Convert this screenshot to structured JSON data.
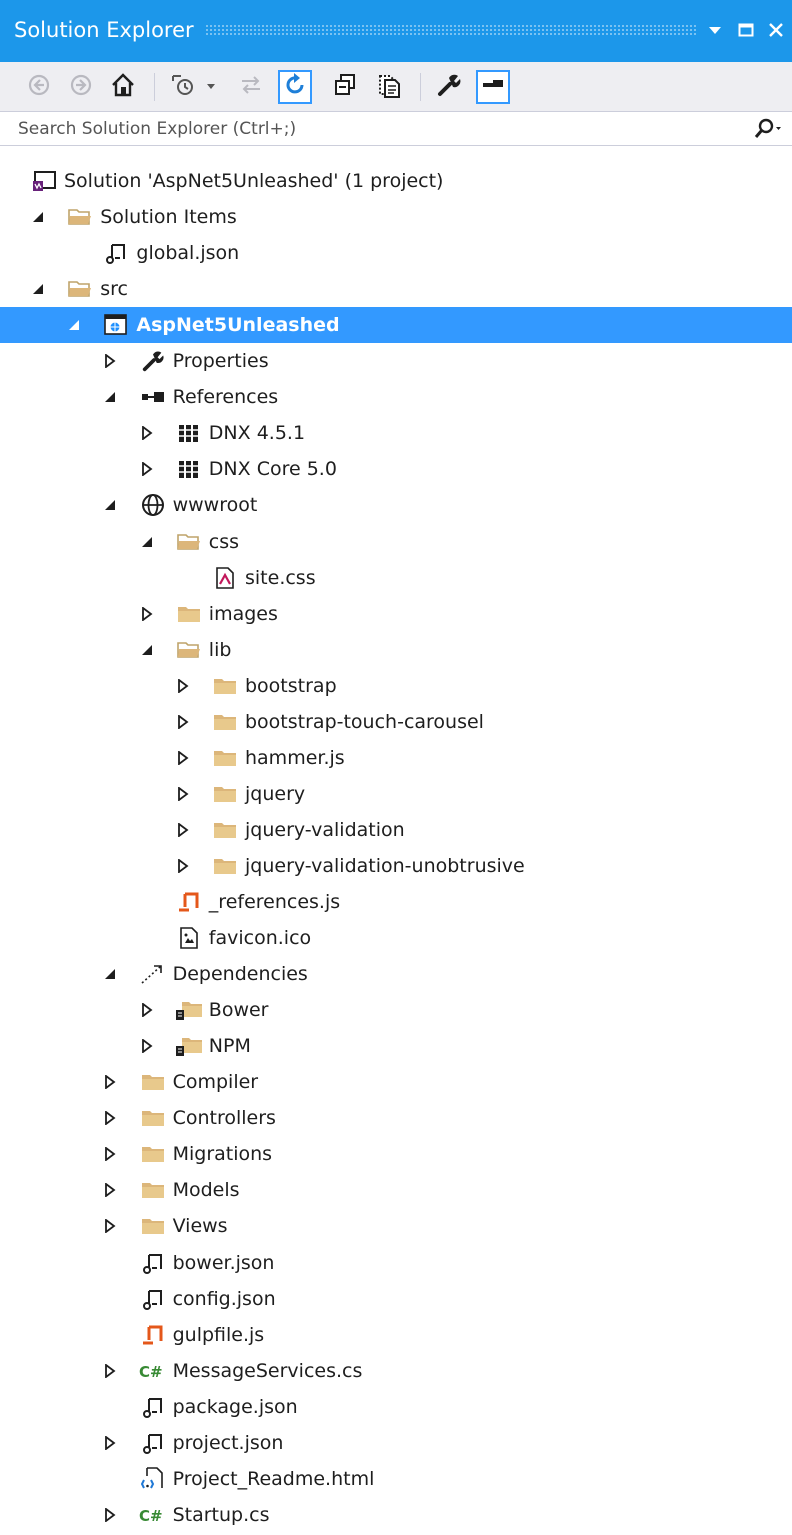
{
  "window": {
    "title": "Solution Explorer",
    "controls": {
      "dropdown_icon": "dropdown-arrow-icon",
      "maximize_icon": "maximize-icon",
      "close_icon": "close-icon"
    }
  },
  "toolbar": {
    "buttons": [
      {
        "name": "back-button",
        "icon": "back-arrow-icon"
      },
      {
        "name": "forward-button",
        "icon": "forward-arrow-icon"
      },
      {
        "name": "home-button",
        "icon": "home-icon"
      },
      {
        "name": "pending-changes-filter-button",
        "icon": "clock-filter-icon"
      },
      {
        "name": "sync-active-document-button",
        "icon": "sync-arrows-icon"
      },
      {
        "name": "refresh-button",
        "icon": "refresh-icon"
      },
      {
        "name": "collapse-all-button",
        "icon": "collapse-all-icon"
      },
      {
        "name": "show-all-files-button",
        "icon": "show-all-files-icon"
      },
      {
        "name": "properties-button",
        "icon": "wrench-icon"
      },
      {
        "name": "preview-selected-items-button",
        "icon": "preview-icon"
      }
    ]
  },
  "search": {
    "placeholder": "Search Solution Explorer (Ctrl+;)",
    "value": ""
  },
  "colors": {
    "title_bar": "#1c97ea",
    "selection": "#3399ff",
    "toolbar_bg": "#eeeef2",
    "folder": "#dcb67a",
    "csharp": "#388a34",
    "js_orange": "#e4571a"
  },
  "tree": [
    {
      "label": "Solution 'AspNet5Unleashed' (1 project)",
      "icon": "solution-icon",
      "expander": "none",
      "depth": 0
    },
    {
      "label": "Solution Items",
      "icon": "folder-open-icon",
      "expander": "expanded",
      "depth": 1
    },
    {
      "label": "global.json",
      "icon": "json-file-icon",
      "expander": "none",
      "depth": 2
    },
    {
      "label": "src",
      "icon": "folder-open-icon",
      "expander": "expanded",
      "depth": 1
    },
    {
      "label": "AspNet5Unleashed",
      "icon": "web-project-icon",
      "expander": "expanded",
      "depth": 2,
      "selected": true
    },
    {
      "label": "Properties",
      "icon": "wrench-icon",
      "expander": "collapsed",
      "depth": 3
    },
    {
      "label": "References",
      "icon": "references-icon",
      "expander": "expanded",
      "depth": 3
    },
    {
      "label": "DNX 4.5.1",
      "icon": "library-icon",
      "expander": "collapsed",
      "depth": 4
    },
    {
      "label": "DNX Core 5.0",
      "icon": "library-icon",
      "expander": "collapsed",
      "depth": 4
    },
    {
      "label": "wwwroot",
      "icon": "globe-icon",
      "expander": "expanded",
      "depth": 3
    },
    {
      "label": "css",
      "icon": "folder-open-icon",
      "expander": "expanded",
      "depth": 4
    },
    {
      "label": "site.css",
      "icon": "css-file-icon",
      "expander": "none",
      "depth": 5
    },
    {
      "label": "images",
      "icon": "folder-icon",
      "expander": "collapsed",
      "depth": 4
    },
    {
      "label": "lib",
      "icon": "folder-open-icon",
      "expander": "expanded",
      "depth": 4
    },
    {
      "label": "bootstrap",
      "icon": "folder-icon",
      "expander": "collapsed",
      "depth": 5
    },
    {
      "label": "bootstrap-touch-carousel",
      "icon": "folder-icon",
      "expander": "collapsed",
      "depth": 5
    },
    {
      "label": "hammer.js",
      "icon": "folder-icon",
      "expander": "collapsed",
      "depth": 5
    },
    {
      "label": "jquery",
      "icon": "folder-icon",
      "expander": "collapsed",
      "depth": 5
    },
    {
      "label": "jquery-validation",
      "icon": "folder-icon",
      "expander": "collapsed",
      "depth": 5
    },
    {
      "label": "jquery-validation-unobtrusive",
      "icon": "folder-icon",
      "expander": "collapsed",
      "depth": 5
    },
    {
      "label": "_references.js",
      "icon": "js-file-icon",
      "expander": "none",
      "depth": 4
    },
    {
      "label": "favicon.ico",
      "icon": "image-file-icon",
      "expander": "none",
      "depth": 4
    },
    {
      "label": "Dependencies",
      "icon": "dependencies-icon",
      "expander": "expanded",
      "depth": 3
    },
    {
      "label": "Bower",
      "icon": "package-folder-icon",
      "expander": "collapsed",
      "depth": 4
    },
    {
      "label": "NPM",
      "icon": "package-folder-icon",
      "expander": "collapsed",
      "depth": 4
    },
    {
      "label": "Compiler",
      "icon": "folder-icon",
      "expander": "collapsed",
      "depth": 3
    },
    {
      "label": "Controllers",
      "icon": "folder-icon",
      "expander": "collapsed",
      "depth": 3
    },
    {
      "label": "Migrations",
      "icon": "folder-icon",
      "expander": "collapsed",
      "depth": 3
    },
    {
      "label": "Models",
      "icon": "folder-icon",
      "expander": "collapsed",
      "depth": 3
    },
    {
      "label": "Views",
      "icon": "folder-icon",
      "expander": "collapsed",
      "depth": 3
    },
    {
      "label": "bower.json",
      "icon": "json-file-icon",
      "expander": "none",
      "depth": 3
    },
    {
      "label": "config.json",
      "icon": "json-file-icon",
      "expander": "none",
      "depth": 3
    },
    {
      "label": "gulpfile.js",
      "icon": "js-file-icon",
      "expander": "none",
      "depth": 3
    },
    {
      "label": "MessageServices.cs",
      "icon": "csharp-file-icon",
      "expander": "collapsed",
      "depth": 3
    },
    {
      "label": "package.json",
      "icon": "json-file-icon",
      "expander": "none",
      "depth": 3
    },
    {
      "label": "project.json",
      "icon": "json-file-icon",
      "expander": "collapsed",
      "depth": 3
    },
    {
      "label": "Project_Readme.html",
      "icon": "html-file-icon",
      "expander": "none",
      "depth": 3
    },
    {
      "label": "Startup.cs",
      "icon": "csharp-file-icon",
      "expander": "collapsed",
      "depth": 3
    }
  ]
}
